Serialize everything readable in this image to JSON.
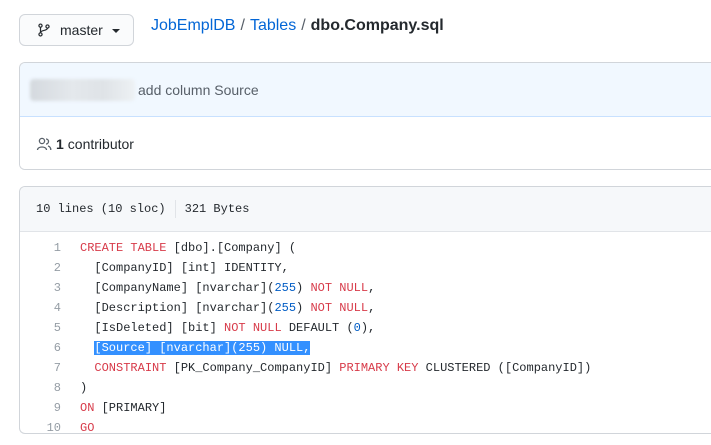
{
  "branch": {
    "label": "master",
    "icon": "git-branch-icon"
  },
  "breadcrumb": {
    "repo": "JobEmplDB",
    "folder": "Tables",
    "separator": "/",
    "file": "dbo.Company.sql"
  },
  "commit": {
    "message": "add column Source"
  },
  "contributors": {
    "count": "1",
    "label": "contributor",
    "icon": "people-icon"
  },
  "file_info": {
    "lines": "10 lines (10 sloc)",
    "size": "321 Bytes"
  },
  "code_lines": [
    {
      "n": "1",
      "tokens": [
        {
          "t": "CREATE TABLE",
          "c": "kw"
        },
        {
          "t": " [dbo].[Company] (",
          "c": ""
        }
      ]
    },
    {
      "n": "2",
      "tokens": [
        {
          "t": "  [CompanyID] [int] IDENTITY,",
          "c": ""
        }
      ]
    },
    {
      "n": "3",
      "tokens": [
        {
          "t": "  [CompanyName] [nvarchar](",
          "c": ""
        },
        {
          "t": "255",
          "c": "num"
        },
        {
          "t": ") ",
          "c": ""
        },
        {
          "t": "NOT NULL",
          "c": "kw"
        },
        {
          "t": ",",
          "c": ""
        }
      ]
    },
    {
      "n": "4",
      "tokens": [
        {
          "t": "  [Description] [nvarchar](",
          "c": ""
        },
        {
          "t": "255",
          "c": "num"
        },
        {
          "t": ") ",
          "c": ""
        },
        {
          "t": "NOT NULL",
          "c": "kw"
        },
        {
          "t": ",",
          "c": ""
        }
      ]
    },
    {
      "n": "5",
      "tokens": [
        {
          "t": "  [IsDeleted] [bit] ",
          "c": ""
        },
        {
          "t": "NOT NULL",
          "c": "kw"
        },
        {
          "t": " DEFAULT (",
          "c": ""
        },
        {
          "t": "0",
          "c": "num"
        },
        {
          "t": "),",
          "c": ""
        }
      ]
    },
    {
      "n": "6",
      "indent": "  ",
      "selected": "[Source] [nvarchar](255) NULL,"
    },
    {
      "n": "7",
      "tokens": [
        {
          "t": "  ",
          "c": ""
        },
        {
          "t": "CONSTRAINT",
          "c": "kw"
        },
        {
          "t": " [PK_Company_CompanyID] ",
          "c": ""
        },
        {
          "t": "PRIMARY KEY",
          "c": "kw"
        },
        {
          "t": " CLUSTERED ([CompanyID])",
          "c": ""
        }
      ]
    },
    {
      "n": "8",
      "tokens": [
        {
          "t": ")",
          "c": ""
        }
      ]
    },
    {
      "n": "9",
      "tokens": [
        {
          "t": "ON",
          "c": "kw"
        },
        {
          "t": " [PRIMARY]",
          "c": ""
        }
      ]
    },
    {
      "n": "10",
      "tokens": [
        {
          "t": "GO",
          "c": "kw"
        }
      ]
    }
  ],
  "colors": {
    "link": "#0366d6",
    "keyword": "#d73a49",
    "number": "#005cc5",
    "selection": "#3390ff",
    "commit_bg": "#f1f8ff"
  }
}
